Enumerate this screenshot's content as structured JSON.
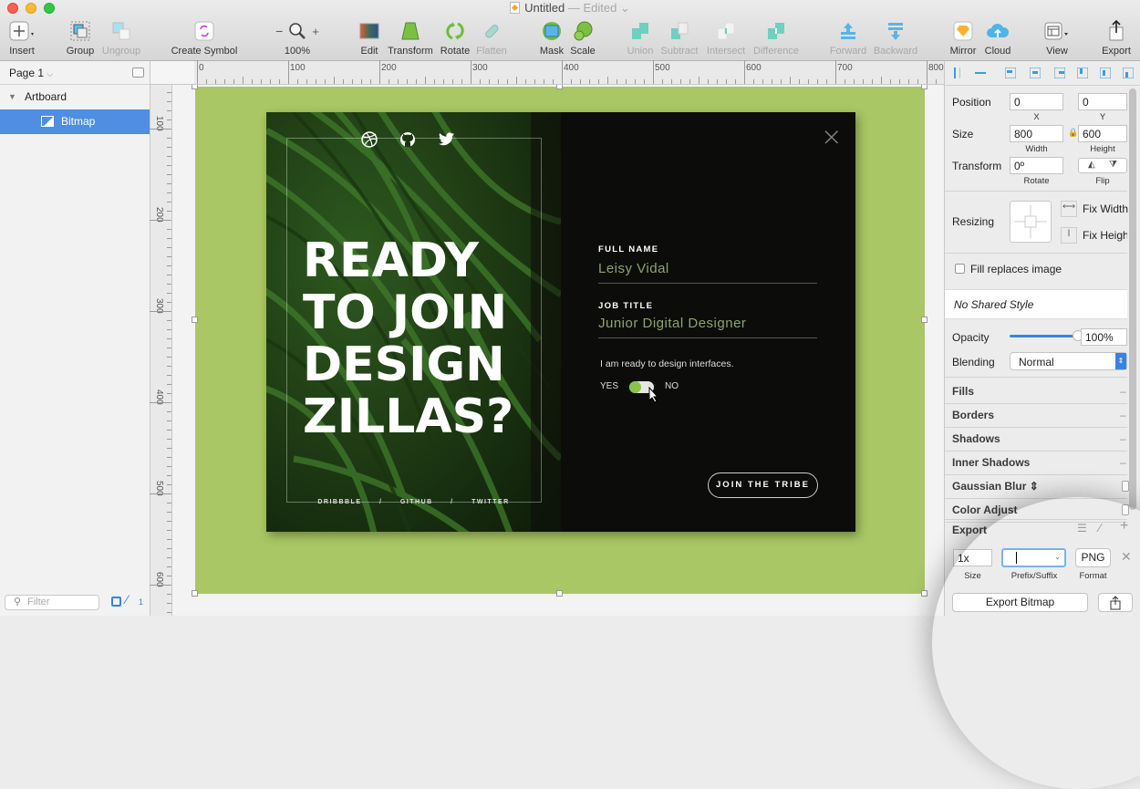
{
  "window": {
    "title": "Untitled",
    "title_suffix": "— Edited",
    "title_chevron": "⌄"
  },
  "toolbar": {
    "insert": "Insert",
    "group": "Group",
    "ungroup": "Ungroup",
    "create_symbol": "Create Symbol",
    "zoom_minus": "−",
    "zoom_plus": "+",
    "zoom_level": "100%",
    "edit": "Edit",
    "transform": "Transform",
    "rotate": "Rotate",
    "flatten": "Flatten",
    "mask": "Mask",
    "scale": "Scale",
    "union": "Union",
    "subtract": "Subtract",
    "intersect": "Intersect",
    "difference": "Difference",
    "forward": "Forward",
    "backward": "Backward",
    "mirror": "Mirror",
    "cloud": "Cloud",
    "view": "View",
    "export": "Export"
  },
  "sidebar": {
    "page": "Page 1",
    "layers": [
      {
        "name": "Artboard",
        "type": "artboard"
      },
      {
        "name": "Bitmap",
        "type": "bitmap",
        "selected": true
      }
    ],
    "filter_placeholder": "Filter",
    "edited_count": "1"
  },
  "rulers": {
    "horizontal": [
      "0",
      "100",
      "200",
      "300",
      "400",
      "500",
      "600",
      "700",
      "800"
    ],
    "vertical": [
      "100",
      "200",
      "300",
      "400",
      "500",
      "600"
    ]
  },
  "design": {
    "headline": [
      "READY",
      "TO JOIN",
      "DESIGN",
      "ZILLAS?"
    ],
    "social_icons": [
      "dribbble-icon",
      "github-icon",
      "twitter-icon"
    ],
    "social_links": [
      "DRIBBBLE",
      "/",
      "GITHUB",
      "/",
      "TWITTER"
    ],
    "full_name_label": "FULL NAME",
    "full_name_value": "Leisy Vidal",
    "job_title_label": "JOB TITLE",
    "job_title_value": "Junior Digital Designer",
    "consent_text": "I am ready to design interfaces.",
    "yes": "YES",
    "no": "NO",
    "cta": "JOIN THE TRIBE",
    "close": "×",
    "accent": "#8bc34a",
    "artboard_bg": "#a9c764"
  },
  "inspector": {
    "position_label": "Position",
    "x": "0",
    "y": "0",
    "x_label": "X",
    "y_label": "Y",
    "size_label": "Size",
    "width": "800",
    "height": "600",
    "width_label": "Width",
    "height_label": "Height",
    "transform_label": "Transform",
    "rotate": "0º",
    "rotate_label": "Rotate",
    "flip_label": "Flip",
    "resizing_label": "Resizing",
    "fix_width": "Fix Width",
    "fix_height": "Fix Height",
    "fill_replaces": "Fill replaces image",
    "shared_style": "No Shared Style",
    "opacity_label": "Opacity",
    "opacity": "100%",
    "opacity_value": 1.0,
    "blending_label": "Blending",
    "blending": "Normal",
    "sections": [
      "Fills",
      "Borders",
      "Shadows",
      "Inner Shadows",
      "Gaussian Blur",
      "Color Adjust"
    ],
    "export_label": "Export",
    "export_size": "1x",
    "export_prefix": "",
    "export_format": "PNG",
    "size_sub": "Size",
    "prefix_sub": "Prefix/Suffix",
    "format_sub": "Format",
    "export_button": "Export Bitmap"
  }
}
